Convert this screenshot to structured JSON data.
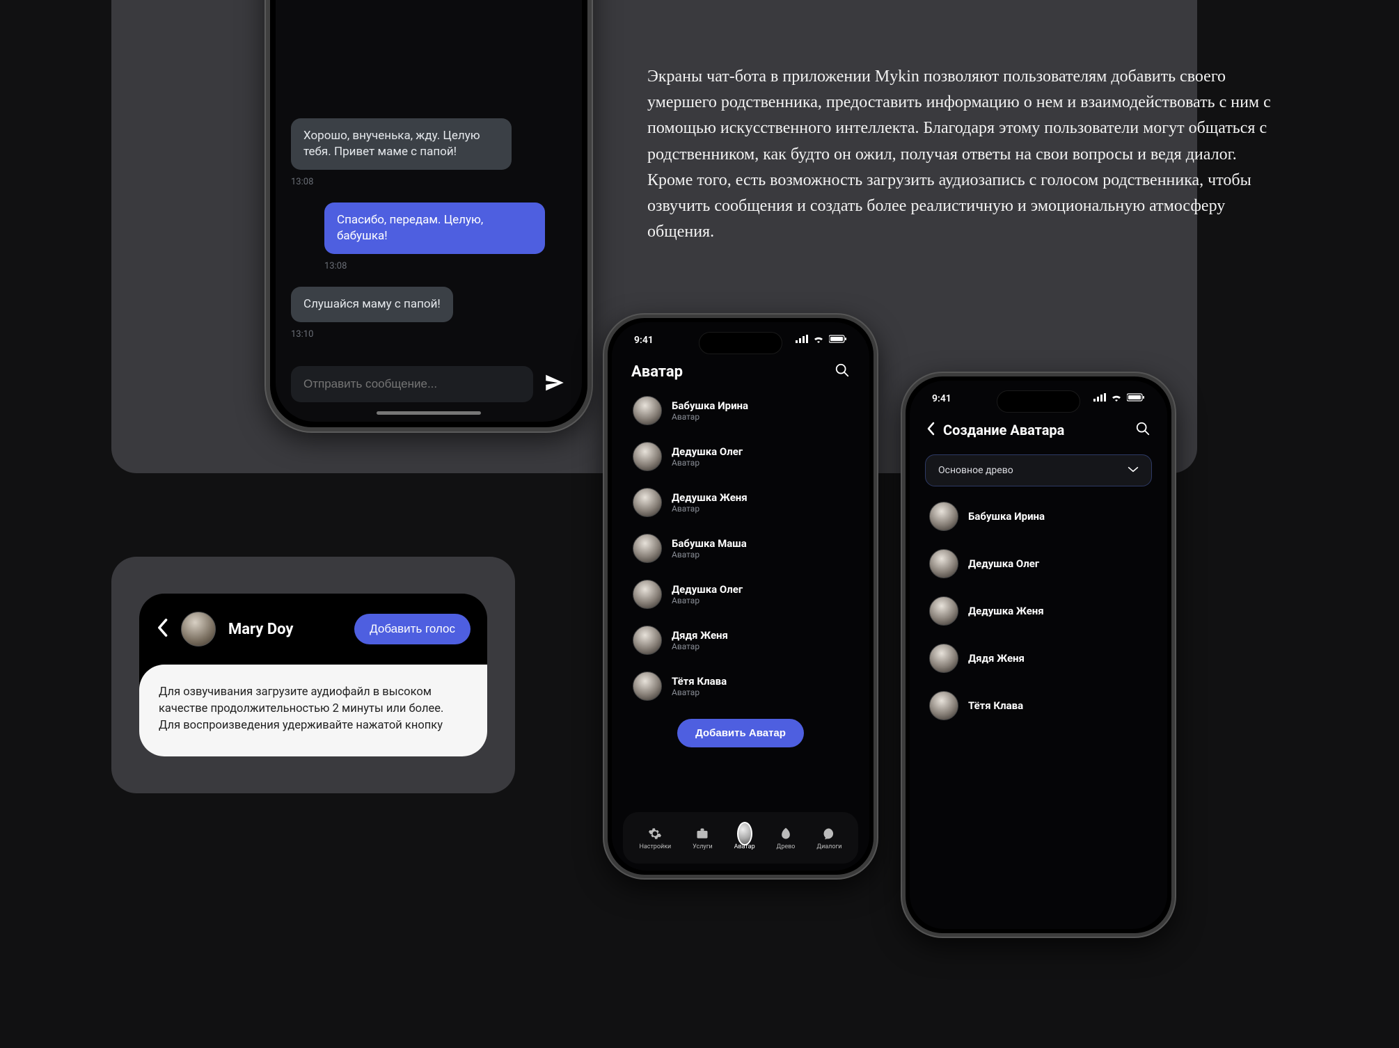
{
  "description": "Экраны чат-бота в приложении Mykin позволяют пользователям добавить своего умершего родственника, предоставить информацию о нем и взаимодействовать с ним с помощью искусственного интеллекта. Благодаря этому пользователи могут общаться с родственником, как будто он ожил, получая ответы на свои вопросы и ведя диалог. Кроме того, есть возможность загрузить аудиозапись с голосом родственника, чтобы озвучить сообщения и создать более реалистичную и эмоциональную атмосферу общения.",
  "chat": {
    "messages": [
      {
        "side": "grey",
        "text": "Хорошо, внученька, жду. Целую тебя. Привет маме с папой!",
        "time": "13:08"
      },
      {
        "side": "blue",
        "text": "Спасибо, передам. Целую, бабушка!",
        "time": "13:08"
      },
      {
        "side": "grey",
        "text": "Слушайся маму с папой!",
        "time": "13:10"
      }
    ],
    "placeholder": "Отправить сообщение..."
  },
  "voice_card": {
    "name": "Mary Doy",
    "add_label": "Добавить голос",
    "body": "Для озвучивания загрузите аудиофайл в высоком качестве продолжительностью 2 минуты или более. Для воспроизведения удерживайте нажатой кнопку"
  },
  "status_time": "9:41",
  "phone2": {
    "title": "Аватар",
    "subtitle": "Аватар",
    "items": [
      {
        "name": "Бабушка Ирина"
      },
      {
        "name": "Дедушка Олег"
      },
      {
        "name": "Дедушка Женя"
      },
      {
        "name": "Бабушка Маша"
      },
      {
        "name": "Дедушка Олег"
      },
      {
        "name": "Дядя Женя"
      },
      {
        "name": "Тётя Клава"
      }
    ],
    "add_label": "Добавить Аватар",
    "tabs": {
      "settings": "Настройки",
      "services": "Услуги",
      "avatar": "Аватар",
      "tree": "Древо",
      "dialogs": "Диалоги"
    }
  },
  "phone3": {
    "title": "Создание Аватара",
    "select_label": "Основное древо",
    "items": [
      {
        "name": "Бабушка Ирина"
      },
      {
        "name": "Дедушка Олег"
      },
      {
        "name": "Дедушка Женя"
      },
      {
        "name": "Дядя Женя"
      },
      {
        "name": "Тётя Клава"
      }
    ]
  }
}
